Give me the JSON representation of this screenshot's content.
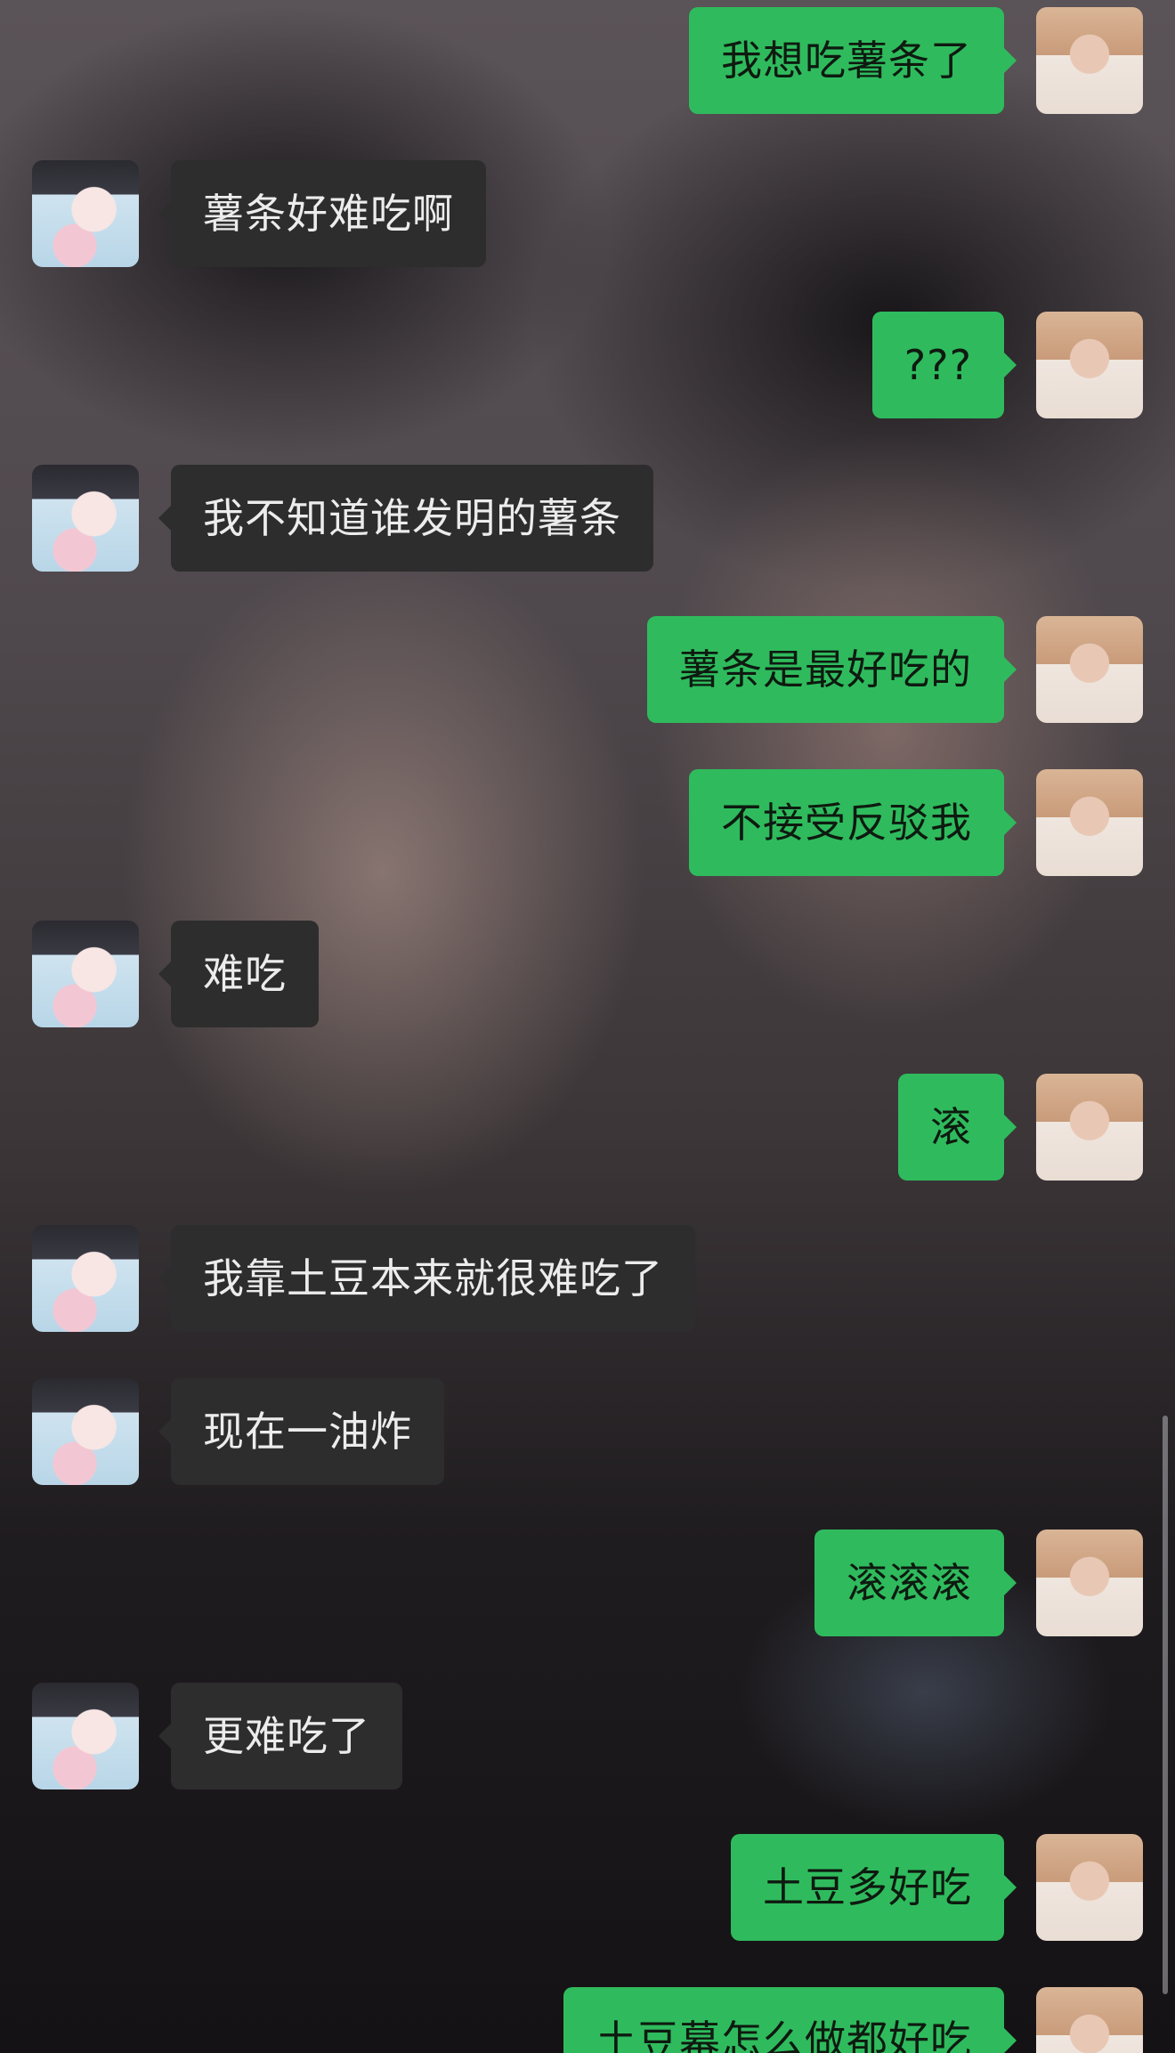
{
  "messages": [
    {
      "side": "right",
      "text": "我想吃薯条了"
    },
    {
      "side": "left",
      "text": "薯条好难吃啊"
    },
    {
      "side": "right",
      "text": "???"
    },
    {
      "side": "left",
      "text": "我不知道谁发明的薯条"
    },
    {
      "side": "right",
      "text": "薯条是最好吃的"
    },
    {
      "side": "right",
      "text": "不接受反驳我"
    },
    {
      "side": "left",
      "text": "难吃"
    },
    {
      "side": "right",
      "text": "滚"
    },
    {
      "side": "left",
      "text": "我靠土豆本来就很难吃了"
    },
    {
      "side": "left",
      "text": "现在一油炸"
    },
    {
      "side": "right",
      "text": "滚滚滚"
    },
    {
      "side": "left",
      "text": "更难吃了"
    },
    {
      "side": "right",
      "text": "土豆多好吃"
    },
    {
      "side": "right",
      "text": "土豆幕怎么做都好吃"
    }
  ]
}
